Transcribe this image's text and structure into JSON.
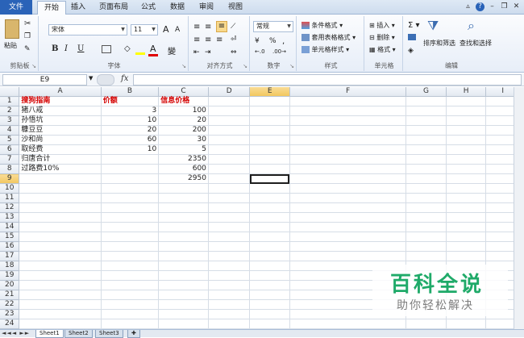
{
  "tabs": [
    "文件",
    "开始",
    "插入",
    "页面布局",
    "公式",
    "数据",
    "审阅",
    "视图"
  ],
  "ribbon": {
    "clipboard": {
      "label": "剪贴板",
      "paste": "粘贴"
    },
    "font": {
      "label": "字体",
      "name": "宋体",
      "size": "11",
      "grow": "A",
      "shrink": "A",
      "bold": "B",
      "italic": "I",
      "underline": "U",
      "font_color_letter": "A",
      "phonetic": "變"
    },
    "alignment": {
      "label": "对齐方式"
    },
    "number": {
      "label": "数字",
      "format": "常规",
      "percent": "%",
      "comma": ","
    },
    "styles": {
      "label": "样式",
      "conditional": "条件格式",
      "table": "套用表格格式",
      "cell": "单元格样式"
    },
    "cells": {
      "label": "单元格",
      "insert": "插入",
      "delete": "删除",
      "format": "格式"
    },
    "editing": {
      "label": "编辑",
      "sigma": "Σ",
      "sort_filter": "排序和筛选",
      "find_select": "查找和选择"
    }
  },
  "formula_bar": {
    "cell_ref": "E9",
    "fx": "fx",
    "value": ""
  },
  "columns": [
    "A",
    "B",
    "C",
    "D",
    "E",
    "F",
    "G",
    "H",
    "I"
  ],
  "rows": [
    [
      "搜狗指南",
      "价额",
      "信息价格"
    ],
    [
      "猪八戒",
      "3",
      "100"
    ],
    [
      "孙悟坑",
      "10",
      "20"
    ],
    [
      "糠豆豆",
      "20",
      "200"
    ],
    [
      "沙和尚",
      "60",
      "30"
    ],
    [
      "取经费",
      "10",
      "5"
    ],
    [
      "归唐合计",
      "",
      "2350"
    ],
    [
      "过路费10%",
      "",
      "600"
    ],
    [
      "",
      "",
      "2950"
    ]
  ],
  "total_rows": 24,
  "sheets": [
    "Sheet1",
    "Sheet2",
    "Sheet3"
  ],
  "watermark": {
    "title": "百科全说",
    "subtitle": "助你轻松解决"
  }
}
